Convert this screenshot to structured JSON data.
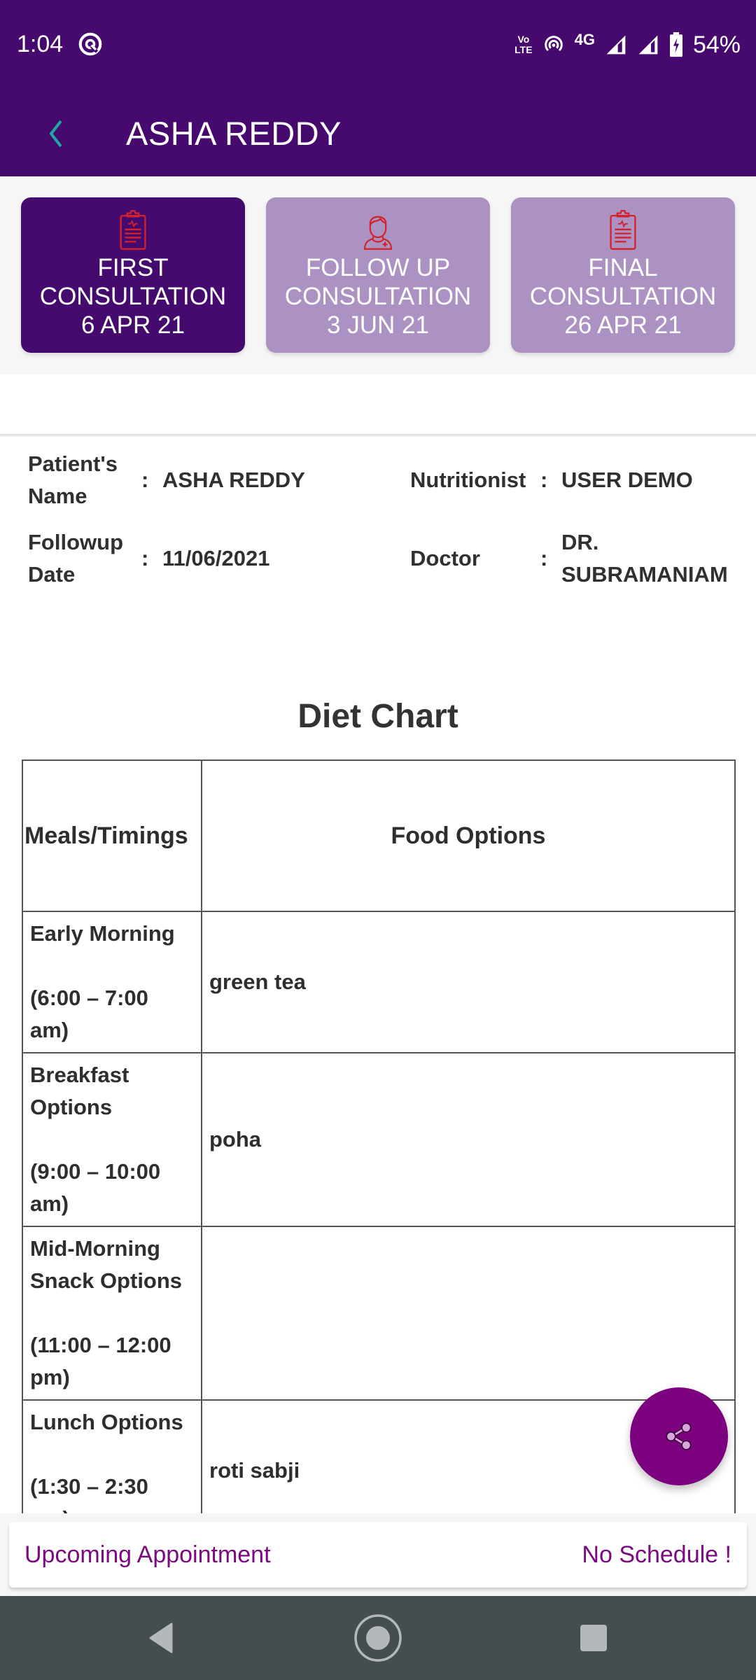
{
  "status_bar": {
    "time": "1:04",
    "battery": "54%",
    "network": "4G",
    "volte": "Vo LTE",
    "icons": [
      "data-saver-icon",
      "volte-icon",
      "hotspot-icon",
      "signal-icon",
      "signal-icon",
      "battery-charging-icon"
    ]
  },
  "app_bar": {
    "title": "ASHA REDDY",
    "back_icon": "chevron-left-icon"
  },
  "consultations": [
    {
      "line1": "FIRST",
      "line2": "CONSULTATION",
      "date": "6 APR 21",
      "icon": "clipboard-icon",
      "active": true
    },
    {
      "line1": "FOLLOW UP",
      "line2": "CONSULTATION",
      "date": "3 JUN 21",
      "icon": "doctor-icon",
      "active": false
    },
    {
      "line1": "FINAL",
      "line2": "CONSULTATION",
      "date": "26 APR 21",
      "icon": "clipboard-icon",
      "active": false
    }
  ],
  "patient_info": {
    "patient_name_label_1": "Patient's",
    "patient_name_label_2": "Name",
    "patient_name": "ASHA REDDY",
    "followup_label_1": "Followup",
    "followup_label_2": "Date",
    "followup_date": "11/06/2021",
    "nutritionist_label": "Nutritionist",
    "nutritionist": "USER DEMO",
    "doctor_label": "Doctor",
    "doctor_1": "DR.",
    "doctor_2": "SUBRAMANIAM",
    "colon": ":"
  },
  "diet_chart": {
    "title": "Diet Chart",
    "headers": {
      "meal": "Meals/Timings",
      "food": "Food Options"
    },
    "rows": [
      {
        "meal_lines": [
          "Early Morning"
        ],
        "time_lines": [
          "(6:00 – 7:00",
          "am)"
        ],
        "food": "green tea"
      },
      {
        "meal_lines": [
          "Breakfast",
          "Options"
        ],
        "time_lines": [
          "(9:00 – 10:00",
          "am)"
        ],
        "food": "poha"
      },
      {
        "meal_lines": [
          "Mid-Morning",
          "Snack Options"
        ],
        "time_lines": [
          "(11:00 – 12:00",
          "pm)"
        ],
        "food": ""
      },
      {
        "meal_lines": [
          "Lunch Options"
        ],
        "time_lines": [
          "(1:30 – 2:30",
          "pm)"
        ],
        "food": "roti sabji"
      }
    ]
  },
  "fab": {
    "icon": "share-icon"
  },
  "appointment": {
    "label": "Upcoming Appointment",
    "status": "No Schedule !"
  },
  "colors": {
    "primary": "#460a6e",
    "tab_inactive": "#ab92c3",
    "accent": "#7c017e",
    "icon_red": "#d3222a",
    "back_teal": "#1fa8a0"
  }
}
